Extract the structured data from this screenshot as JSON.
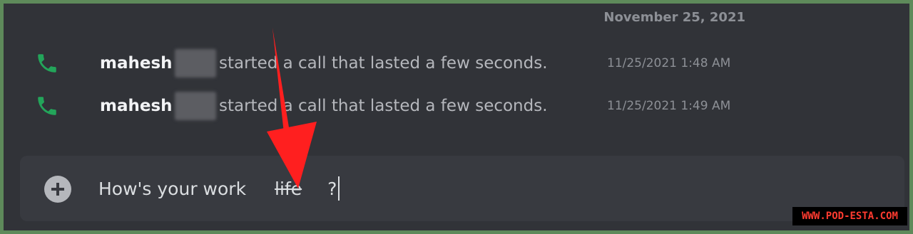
{
  "chat": {
    "date_divider": "November 25, 2021",
    "messages": [
      {
        "icon": "phone-icon",
        "author": "mahesh",
        "text": "started a call that lasted a few seconds.",
        "timestamp": "11/25/2021 1:48 AM"
      },
      {
        "icon": "phone-icon",
        "author": "mahesh",
        "text": "started a call that lasted a few seconds.",
        "timestamp": "11/25/2021 1:49 AM"
      }
    ]
  },
  "composer": {
    "text_before": "How's your work",
    "strikethrough_text": "life",
    "text_after": "?"
  },
  "watermark": "WWW.POD-ESTA.COM",
  "colors": {
    "background": "#313338",
    "composer": "#383a40",
    "call_icon": "#23a55a",
    "arrow": "#ff1f1f",
    "frame": "#5e8a5a"
  }
}
